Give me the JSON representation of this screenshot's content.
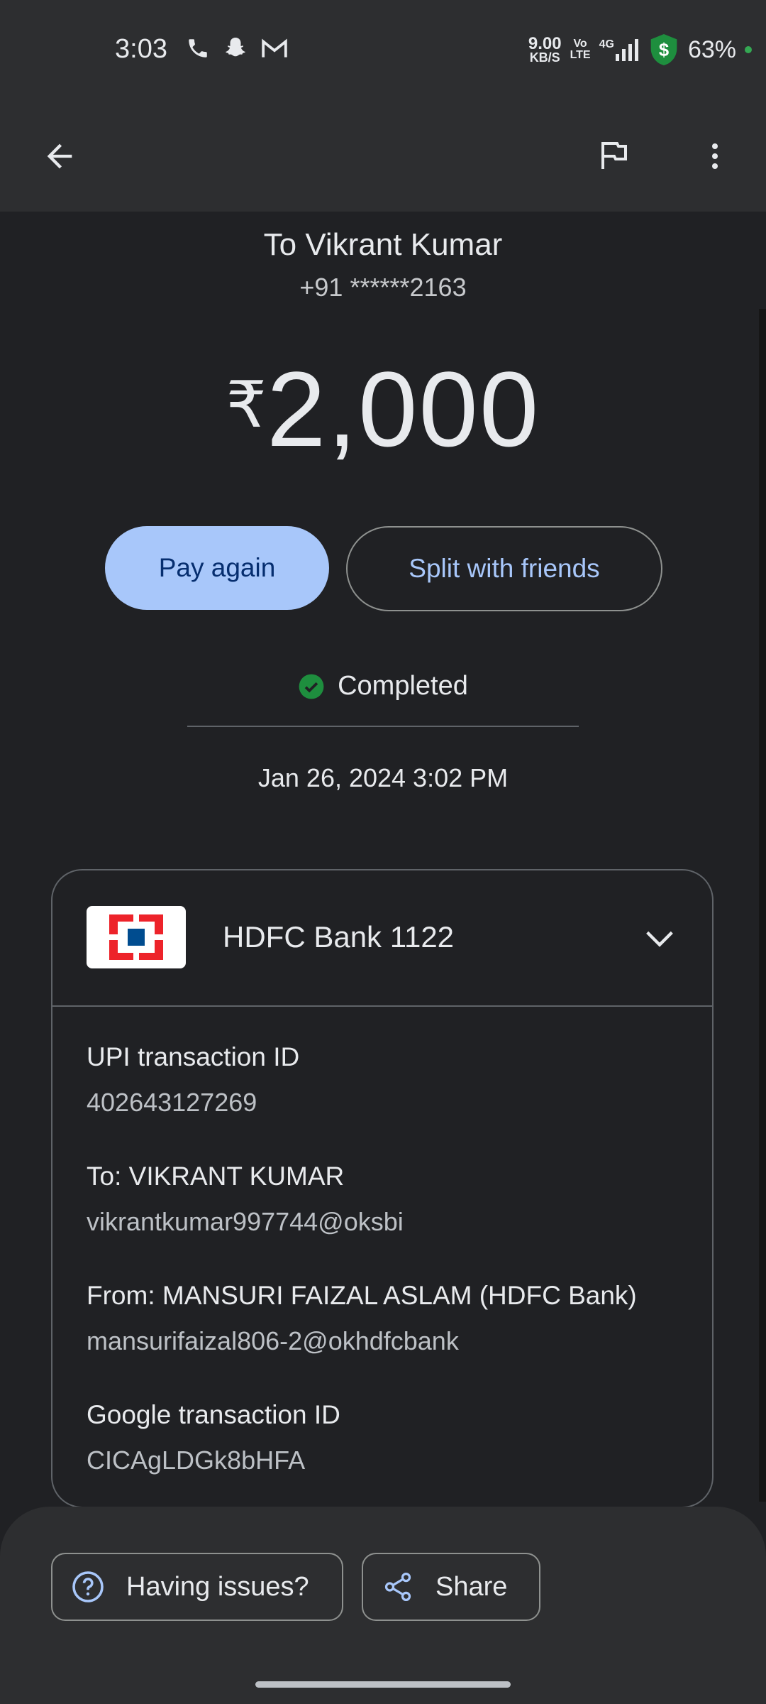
{
  "status_bar": {
    "time": "3:03",
    "net_speed_value": "9.00",
    "net_speed_unit": "KB/S",
    "volte_top": "Vo",
    "volte_bottom": "LTE",
    "network": "4G",
    "battery": "63%"
  },
  "transaction": {
    "to_name": "To Vikrant Kumar",
    "phone": "+91 ******2163",
    "currency": "₹",
    "amount": "2,000",
    "pay_again_label": "Pay again",
    "split_label": "Split with friends",
    "status": "Completed",
    "datetime": "Jan 26, 2024 3:02 PM"
  },
  "details": {
    "bank_name": "HDFC Bank 1122",
    "upi_label": "UPI transaction ID",
    "upi_value": "402643127269",
    "to_label": "To: VIKRANT KUMAR",
    "to_value": "vikrantkumar997744@oksbi",
    "from_label": "From: MANSURI FAIZAL ASLAM (HDFC Bank)",
    "from_value": "mansurifaizal806-2@okhdfcbank",
    "google_label": "Google transaction ID",
    "google_value": "CICAgLDGk8bHFA"
  },
  "bottom": {
    "issues_label": "Having issues?",
    "share_label": "Share"
  },
  "colors": {
    "accent": "#a8c7fa",
    "success": "#1e8e3e",
    "hdfc_red": "#ed232a",
    "hdfc_blue": "#004c8f"
  },
  "icons": [
    "phone-icon",
    "snapchat-icon",
    "gmail-icon",
    "signal-icon",
    "shield-dollar-icon",
    "back-arrow-icon",
    "flag-icon",
    "more-vert-icon",
    "check-circle-icon",
    "chevron-down-icon",
    "help-icon",
    "share-icon"
  ]
}
